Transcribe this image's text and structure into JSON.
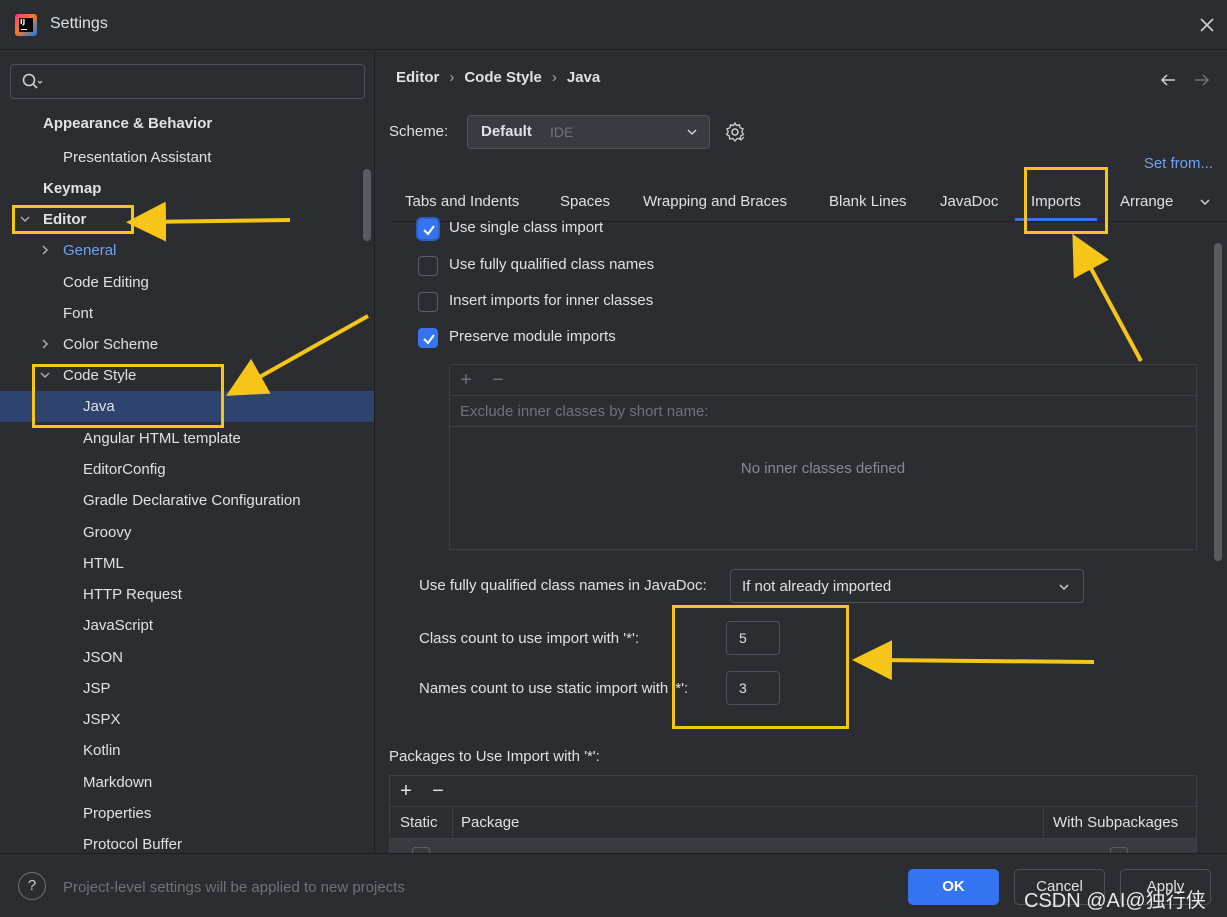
{
  "window": {
    "title": "Settings"
  },
  "sidebar": {
    "search_placeholder": "",
    "items": [
      {
        "label": "Appearance & Behavior"
      },
      {
        "label": "Presentation Assistant"
      },
      {
        "label": "Keymap"
      },
      {
        "label": "Editor"
      },
      {
        "label": "General"
      },
      {
        "label": "Code Editing"
      },
      {
        "label": "Font"
      },
      {
        "label": "Color Scheme"
      },
      {
        "label": "Code Style"
      },
      {
        "label": "Java"
      },
      {
        "label": "Angular HTML template"
      },
      {
        "label": "EditorConfig"
      },
      {
        "label": "Gradle Declarative Configuration"
      },
      {
        "label": "Groovy"
      },
      {
        "label": "HTML"
      },
      {
        "label": "HTTP Request"
      },
      {
        "label": "JavaScript"
      },
      {
        "label": "JSON"
      },
      {
        "label": "JSP"
      },
      {
        "label": "JSPX"
      },
      {
        "label": "Kotlin"
      },
      {
        "label": "Markdown"
      },
      {
        "label": "Properties"
      },
      {
        "label": "Protocol Buffer"
      }
    ]
  },
  "breadcrumb": [
    "Editor",
    "Code Style",
    "Java"
  ],
  "scheme": {
    "label": "Scheme:",
    "value": "Default",
    "sub": "IDE",
    "set_from": "Set from..."
  },
  "tabs": [
    "Tabs and Indents",
    "Spaces",
    "Wrapping and Braces",
    "Blank Lines",
    "JavaDoc",
    "Imports",
    "Arrange"
  ],
  "active_tab": "Imports",
  "options": [
    {
      "label": "Use single class import",
      "checked": true
    },
    {
      "label": "Use fully qualified class names",
      "checked": false
    },
    {
      "label": "Insert imports for inner classes",
      "checked": false
    },
    {
      "label": "Preserve module imports",
      "checked": true
    }
  ],
  "exclude": {
    "header": "Exclude inner classes by short name:",
    "empty": "No inner classes defined"
  },
  "javadoc": {
    "label": "Use fully qualified class names in JavaDoc:",
    "value": "If not already imported"
  },
  "class_count": {
    "label": "Class count to use import with '*':",
    "value": "5"
  },
  "names_count": {
    "label": "Names count to use static import with '*':",
    "value": "3"
  },
  "packages": {
    "label": "Packages to Use Import with '*':",
    "columns": [
      "Static",
      "Package",
      "With Subpackages"
    ]
  },
  "footer": {
    "note": "Project-level settings will be applied to new projects",
    "ok": "OK",
    "cancel": "Cancel",
    "apply": "Apply",
    "watermark": "CSDN @AI@独行侠"
  },
  "colors": {
    "accent": "#3574f0",
    "highlight": "#f5c518",
    "selection": "#2e436e",
    "link": "#6ea3f7"
  }
}
